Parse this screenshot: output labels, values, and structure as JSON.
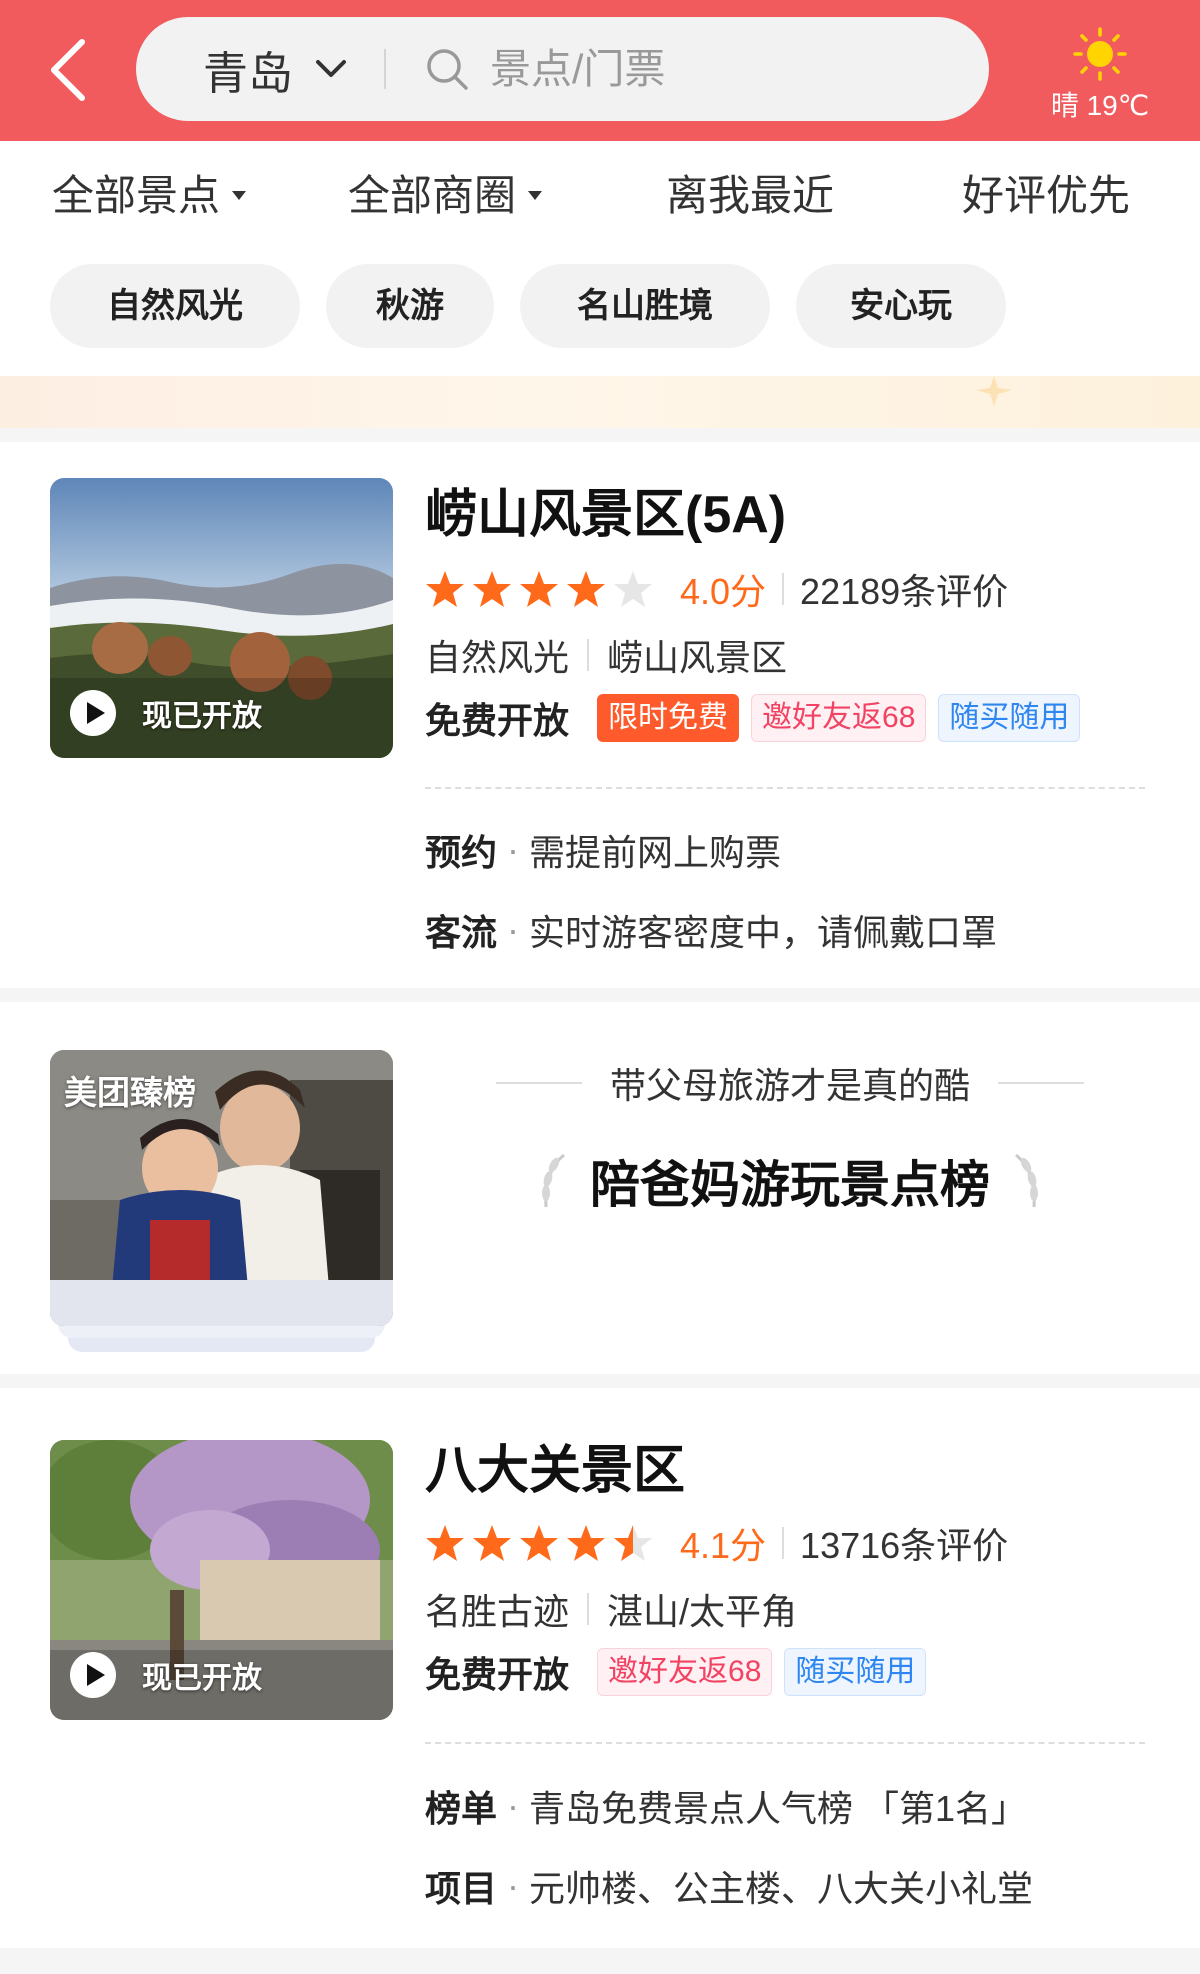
{
  "header": {
    "city": "青岛",
    "search_placeholder": "景点/门票",
    "weather": "晴 19℃",
    "colors": {
      "header_bg": "#f25b5e"
    }
  },
  "filters": [
    {
      "label": "全部景点",
      "dropdown": true
    },
    {
      "label": "全部商圈",
      "dropdown": true
    },
    {
      "label": "离我最近",
      "dropdown": false
    },
    {
      "label": "好评优先",
      "dropdown": false
    }
  ],
  "chips": [
    "自然风光",
    "秋游",
    "名山胜境",
    "安心玩"
  ],
  "listings": [
    {
      "title": "崂山风景区(5A)",
      "rating": 4.0,
      "score": "4.0分",
      "reviews": "22189条评价",
      "category": "自然风光",
      "area": "崂山风景区",
      "price": "免费开放",
      "tags": [
        "限时免费",
        "邀好友返68",
        "随买随用"
      ],
      "badge": "现已开放",
      "info": [
        {
          "label": "预约",
          "text": "需提前网上购票"
        },
        {
          "label": "客流",
          "text": "实时游客密度中，请佩戴口罩"
        }
      ]
    },
    {
      "title": "八大关景区",
      "rating": 4.1,
      "score": "4.1分",
      "reviews": "13716条评价",
      "category": "名胜古迹",
      "area": "湛山/太平角",
      "price": "免费开放",
      "tags": [
        "邀好友返68",
        "随买随用"
      ],
      "badge": "现已开放",
      "info": [
        {
          "label": "榜单",
          "text": "青岛免费景点人气榜 「第1名」"
        },
        {
          "label": "项目",
          "text": "元帅楼、公主楼、八大关小礼堂"
        }
      ]
    }
  ],
  "ranking": {
    "badge": "美团臻榜",
    "subtitle": "带父母旅游才是真的酷",
    "title": "陪爸妈游玩景点榜"
  },
  "colors": {
    "accent_orange": "#ff6a1a",
    "tag_solid": "#ff5a2c",
    "tag_pink": "#f24364",
    "tag_blue": "#2e86f0",
    "star_empty": "#e6e6e6"
  }
}
